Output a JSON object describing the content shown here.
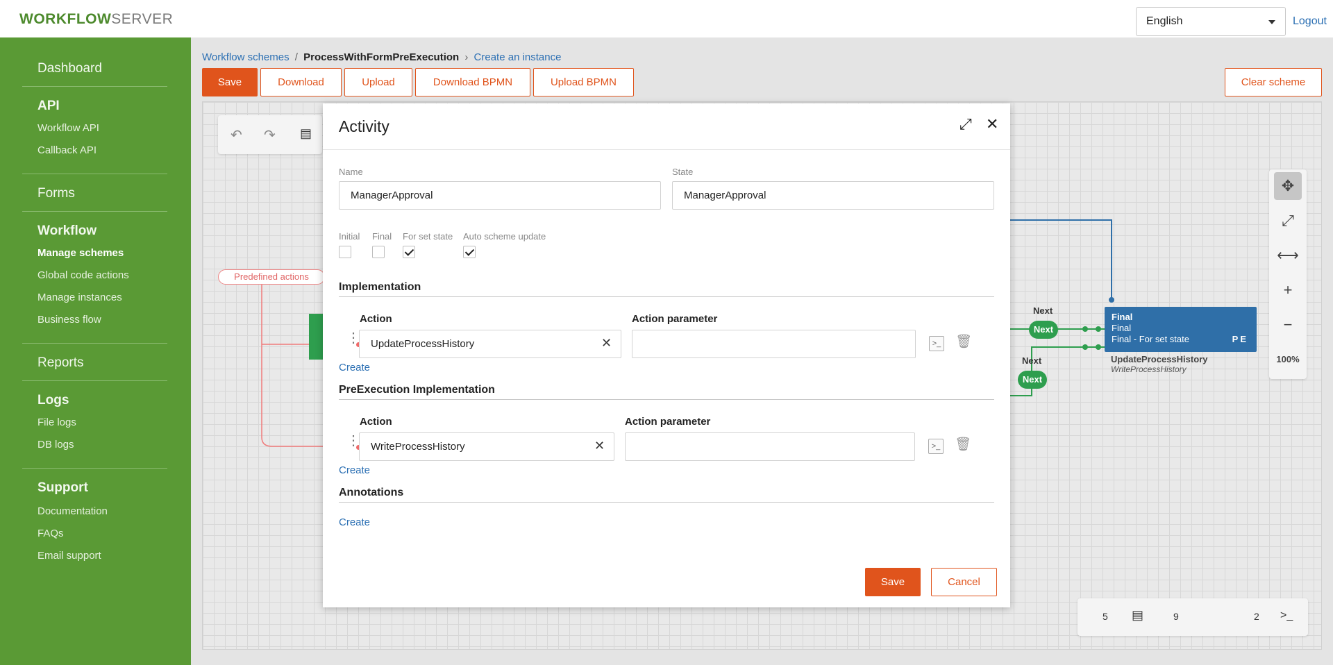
{
  "app": {
    "logo_part1": "WORKFLOW",
    "logo_part2": "SERVER",
    "language": "English",
    "logout": "Logout"
  },
  "sidebar": {
    "dashboard": "Dashboard",
    "api": "API",
    "workflow_api": "Workflow API",
    "callback_api": "Callback API",
    "forms": "Forms",
    "workflow": "Workflow",
    "manage_schemes": "Manage schemes",
    "global_code_actions": "Global code actions",
    "manage_instances": "Manage instances",
    "business_flow": "Business flow",
    "reports": "Reports",
    "logs": "Logs",
    "file_logs": "File logs",
    "db_logs": "DB logs",
    "support": "Support",
    "documentation": "Documentation",
    "faqs": "FAQs",
    "email_support": "Email support"
  },
  "breadcrumb": {
    "root": "Workflow schemes",
    "sep": "/",
    "current": "ProcessWithFormPreExecution",
    "action": "Create an instance"
  },
  "toolbar": {
    "save": "Save",
    "download": "Download",
    "upload": "Upload",
    "download_bpmn": "Download BPMN",
    "upload_bpmn": "Upload BPMN",
    "clear_scheme": "Clear scheme"
  },
  "canvas": {
    "predefined_actions": "Predefined actions",
    "zoom": "100%",
    "bottom": {
      "count1": "5",
      "count2": "9",
      "count3": "2"
    },
    "final_node": {
      "line1": "Final",
      "line2": "Final",
      "line3": "Final - For set state",
      "pe": "PE",
      "label": "UpdateProcessHistory",
      "sublabel": "WriteProcessHistory"
    },
    "next_label1": "Next",
    "next_pill1": "Next",
    "next_label2": "Next",
    "next_pill2": "Next",
    "accent_blue": "#2f6fa8",
    "accent_green": "#2e9e4e"
  },
  "modal": {
    "title": "Activity",
    "name_label": "Name",
    "name_value": "ManagerApproval",
    "state_label": "State",
    "state_value": "ManagerApproval",
    "initial": "Initial",
    "final": "Final",
    "for_set_state": "For set state",
    "auto_scheme_update": "Auto scheme update",
    "checks": {
      "initial": false,
      "final": false,
      "for_set_state": true,
      "auto_scheme_update": true
    },
    "implementation": {
      "title": "Implementation",
      "action_label": "Action",
      "param_label": "Action parameter",
      "action_value": "UpdateProcessHistory",
      "param_value": "",
      "create": "Create"
    },
    "pre_execution": {
      "title": "PreExecution Implementation",
      "action_label": "Action",
      "param_label": "Action parameter",
      "action_value": "WriteProcessHistory",
      "param_value": "",
      "create": "Create"
    },
    "annotations": {
      "title": "Annotations",
      "create": "Create"
    },
    "save": "Save",
    "cancel": "Cancel",
    "brand_orange": "#e0541c"
  }
}
